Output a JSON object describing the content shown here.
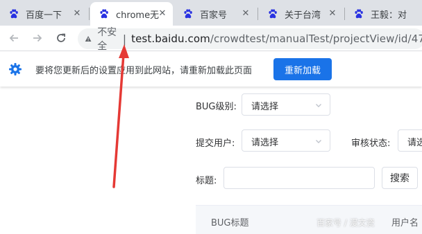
{
  "browser": {
    "tabs": [
      {
        "title": "百度一下",
        "active": false
      },
      {
        "title": "chrome无",
        "active": true
      },
      {
        "title": "百家号",
        "active": false
      },
      {
        "title": "关于台湾",
        "active": false
      },
      {
        "title": "王毅：对",
        "active": false
      }
    ],
    "address_bar": {
      "security_label": "不安全",
      "url_host": "test.baidu.com",
      "url_path": "/crowdtest/manualTest/projectView/id/47"
    }
  },
  "infobar": {
    "message": "要将您更新后的设置应用到此网站，请重新加载此页面",
    "reload_button": "重新加载"
  },
  "filters": {
    "bug_level_label": "BUG级别:",
    "bug_level_value": "请选择",
    "submit_user_label": "提交用户:",
    "submit_user_value": "请选择",
    "review_status_label": "审核状态:",
    "review_status_value": "请选",
    "title_label": "标题:",
    "title_value": "",
    "search_button": "搜索"
  },
  "table": {
    "columns": [
      "BUG标题",
      "用户名"
    ]
  },
  "watermark": "百家号 / 漫文瓷",
  "colors": {
    "accent": "#1a73e8",
    "annotation_arrow": "#e53935"
  },
  "icons": [
    "baidu-paw-icon",
    "close-icon",
    "back-arrow-icon",
    "forward-arrow-icon",
    "reload-icon",
    "warning-icon",
    "gear-icon",
    "chevron-down-icon"
  ]
}
